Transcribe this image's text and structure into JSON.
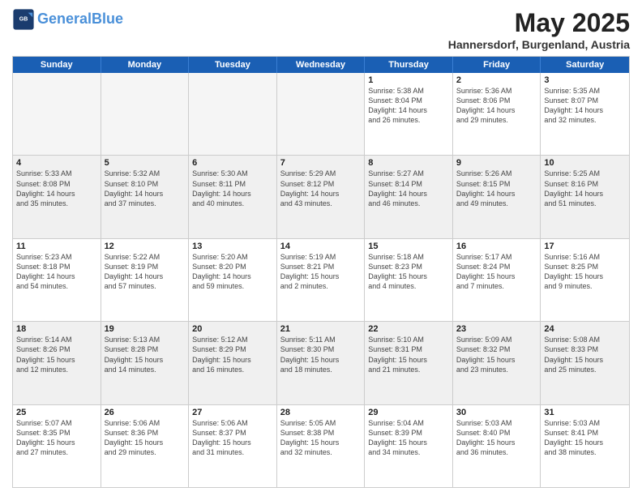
{
  "logo": {
    "line1": "General",
    "line2": "Blue"
  },
  "title": "May 2025",
  "subtitle": "Hannersdorf, Burgenland, Austria",
  "days": [
    "Sunday",
    "Monday",
    "Tuesday",
    "Wednesday",
    "Thursday",
    "Friday",
    "Saturday"
  ],
  "weeks": [
    [
      {
        "day": "",
        "info": ""
      },
      {
        "day": "",
        "info": ""
      },
      {
        "day": "",
        "info": ""
      },
      {
        "day": "",
        "info": ""
      },
      {
        "day": "1",
        "info": "Sunrise: 5:38 AM\nSunset: 8:04 PM\nDaylight: 14 hours\nand 26 minutes."
      },
      {
        "day": "2",
        "info": "Sunrise: 5:36 AM\nSunset: 8:06 PM\nDaylight: 14 hours\nand 29 minutes."
      },
      {
        "day": "3",
        "info": "Sunrise: 5:35 AM\nSunset: 8:07 PM\nDaylight: 14 hours\nand 32 minutes."
      }
    ],
    [
      {
        "day": "4",
        "info": "Sunrise: 5:33 AM\nSunset: 8:08 PM\nDaylight: 14 hours\nand 35 minutes."
      },
      {
        "day": "5",
        "info": "Sunrise: 5:32 AM\nSunset: 8:10 PM\nDaylight: 14 hours\nand 37 minutes."
      },
      {
        "day": "6",
        "info": "Sunrise: 5:30 AM\nSunset: 8:11 PM\nDaylight: 14 hours\nand 40 minutes."
      },
      {
        "day": "7",
        "info": "Sunrise: 5:29 AM\nSunset: 8:12 PM\nDaylight: 14 hours\nand 43 minutes."
      },
      {
        "day": "8",
        "info": "Sunrise: 5:27 AM\nSunset: 8:14 PM\nDaylight: 14 hours\nand 46 minutes."
      },
      {
        "day": "9",
        "info": "Sunrise: 5:26 AM\nSunset: 8:15 PM\nDaylight: 14 hours\nand 49 minutes."
      },
      {
        "day": "10",
        "info": "Sunrise: 5:25 AM\nSunset: 8:16 PM\nDaylight: 14 hours\nand 51 minutes."
      }
    ],
    [
      {
        "day": "11",
        "info": "Sunrise: 5:23 AM\nSunset: 8:18 PM\nDaylight: 14 hours\nand 54 minutes."
      },
      {
        "day": "12",
        "info": "Sunrise: 5:22 AM\nSunset: 8:19 PM\nDaylight: 14 hours\nand 57 minutes."
      },
      {
        "day": "13",
        "info": "Sunrise: 5:20 AM\nSunset: 8:20 PM\nDaylight: 14 hours\nand 59 minutes."
      },
      {
        "day": "14",
        "info": "Sunrise: 5:19 AM\nSunset: 8:21 PM\nDaylight: 15 hours\nand 2 minutes."
      },
      {
        "day": "15",
        "info": "Sunrise: 5:18 AM\nSunset: 8:23 PM\nDaylight: 15 hours\nand 4 minutes."
      },
      {
        "day": "16",
        "info": "Sunrise: 5:17 AM\nSunset: 8:24 PM\nDaylight: 15 hours\nand 7 minutes."
      },
      {
        "day": "17",
        "info": "Sunrise: 5:16 AM\nSunset: 8:25 PM\nDaylight: 15 hours\nand 9 minutes."
      }
    ],
    [
      {
        "day": "18",
        "info": "Sunrise: 5:14 AM\nSunset: 8:26 PM\nDaylight: 15 hours\nand 12 minutes."
      },
      {
        "day": "19",
        "info": "Sunrise: 5:13 AM\nSunset: 8:28 PM\nDaylight: 15 hours\nand 14 minutes."
      },
      {
        "day": "20",
        "info": "Sunrise: 5:12 AM\nSunset: 8:29 PM\nDaylight: 15 hours\nand 16 minutes."
      },
      {
        "day": "21",
        "info": "Sunrise: 5:11 AM\nSunset: 8:30 PM\nDaylight: 15 hours\nand 18 minutes."
      },
      {
        "day": "22",
        "info": "Sunrise: 5:10 AM\nSunset: 8:31 PM\nDaylight: 15 hours\nand 21 minutes."
      },
      {
        "day": "23",
        "info": "Sunrise: 5:09 AM\nSunset: 8:32 PM\nDaylight: 15 hours\nand 23 minutes."
      },
      {
        "day": "24",
        "info": "Sunrise: 5:08 AM\nSunset: 8:33 PM\nDaylight: 15 hours\nand 25 minutes."
      }
    ],
    [
      {
        "day": "25",
        "info": "Sunrise: 5:07 AM\nSunset: 8:35 PM\nDaylight: 15 hours\nand 27 minutes."
      },
      {
        "day": "26",
        "info": "Sunrise: 5:06 AM\nSunset: 8:36 PM\nDaylight: 15 hours\nand 29 minutes."
      },
      {
        "day": "27",
        "info": "Sunrise: 5:06 AM\nSunset: 8:37 PM\nDaylight: 15 hours\nand 31 minutes."
      },
      {
        "day": "28",
        "info": "Sunrise: 5:05 AM\nSunset: 8:38 PM\nDaylight: 15 hours\nand 32 minutes."
      },
      {
        "day": "29",
        "info": "Sunrise: 5:04 AM\nSunset: 8:39 PM\nDaylight: 15 hours\nand 34 minutes."
      },
      {
        "day": "30",
        "info": "Sunrise: 5:03 AM\nSunset: 8:40 PM\nDaylight: 15 hours\nand 36 minutes."
      },
      {
        "day": "31",
        "info": "Sunrise: 5:03 AM\nSunset: 8:41 PM\nDaylight: 15 hours\nand 38 minutes."
      }
    ]
  ]
}
